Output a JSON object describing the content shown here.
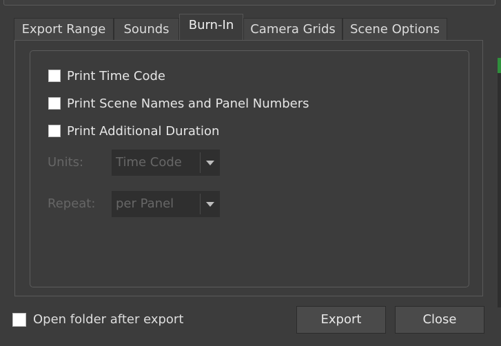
{
  "tabs": [
    {
      "label": "Export Range",
      "active": false
    },
    {
      "label": "Sounds",
      "active": false
    },
    {
      "label": "Burn-In",
      "active": true
    },
    {
      "label": "Camera Grids",
      "active": false
    },
    {
      "label": "Scene Options",
      "active": false
    }
  ],
  "burn_in": {
    "print_time_code": {
      "label": "Print Time Code",
      "checked": false
    },
    "print_scene_names": {
      "label": "Print Scene Names and Panel Numbers",
      "checked": false
    },
    "print_additional_duration": {
      "label": "Print Additional Duration",
      "checked": false
    },
    "units": {
      "label": "Units:",
      "value": "Time Code",
      "enabled": false
    },
    "repeat": {
      "label": "Repeat:",
      "value": "per Panel",
      "enabled": false
    }
  },
  "footer": {
    "open_folder": {
      "label": "Open folder after export",
      "checked": false
    },
    "export_label": "Export",
    "close_label": "Close"
  },
  "colors": {
    "background": "#3c3c3c",
    "disabled_text": "#666666",
    "checkbox": "#ffffff"
  }
}
